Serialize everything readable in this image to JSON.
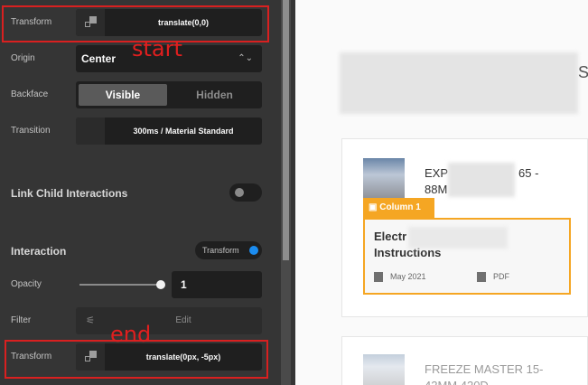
{
  "panel": {
    "transform_start": {
      "label": "Transform",
      "value": "translate(0,0)"
    },
    "origin": {
      "label": "Origin",
      "value": "Center"
    },
    "backface": {
      "label": "Backface",
      "options": [
        "Visible",
        "Hidden"
      ],
      "selected": "Visible"
    },
    "transition": {
      "label": "Transition",
      "value": "300ms / Material Standard"
    },
    "link_child": {
      "label": "Link Child Interactions",
      "enabled": false
    },
    "interaction": {
      "heading": "Interaction",
      "trigger_label": "Transform",
      "accent": "#1b8cf0"
    },
    "opacity": {
      "label": "Opacity",
      "value": "1",
      "level": 1
    },
    "filter": {
      "label": "Filter",
      "button_label": "Edit"
    },
    "transform_end": {
      "label": "Transform",
      "value": "translate(0px, -5px)"
    }
  },
  "annotations": {
    "start": "start",
    "end": "end",
    "color": "#d92020"
  },
  "preview": {
    "heading_fragment": "S",
    "card1": {
      "title_a": "EXP",
      "title_b": "65 -",
      "title_c": "88M"
    },
    "column": {
      "tag": "Column 1",
      "title_a": "Electr",
      "title_b": "Instructions",
      "date": "May 2021",
      "file_type": "PDF",
      "accent": "#f5a623"
    },
    "card2": {
      "title_a": "FREEZE MASTER 15-",
      "title_b": "42MM 420D"
    }
  }
}
